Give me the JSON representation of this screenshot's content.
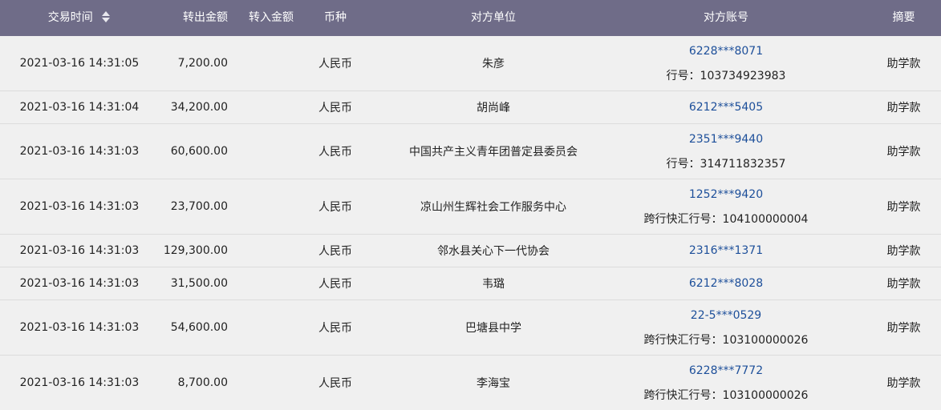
{
  "header": {
    "time": "交易时间",
    "out_amount": "转出金额",
    "in_amount": "转入金额",
    "currency": "币种",
    "counterparty": "对方单位",
    "account": "对方账号",
    "memo": "摘要"
  },
  "rows": [
    {
      "time": "2021-03-16  14:31:05",
      "out": "7,200.00",
      "in": "",
      "currency": "人民币",
      "unit": "朱彦",
      "account": "6228***8071",
      "bank": "行号：103734923983",
      "memo": "助学款"
    },
    {
      "time": "2021-03-16  14:31:04",
      "out": "34,200.00",
      "in": "",
      "currency": "人民币",
      "unit": "胡尚峰",
      "account": "6212***5405",
      "bank": "",
      "memo": "助学款"
    },
    {
      "time": "2021-03-16  14:31:03",
      "out": "60,600.00",
      "in": "",
      "currency": "人民币",
      "unit": "中国共产主义青年团普定县委员会",
      "account": "2351***9440",
      "bank": "行号：314711832357",
      "memo": "助学款"
    },
    {
      "time": "2021-03-16  14:31:03",
      "out": "23,700.00",
      "in": "",
      "currency": "人民币",
      "unit": "凉山州生辉社会工作服务中心",
      "account": "1252***9420",
      "bank": "跨行快汇行号：104100000004",
      "memo": "助学款"
    },
    {
      "time": "2021-03-16  14:31:03",
      "out": "129,300.00",
      "in": "",
      "currency": "人民币",
      "unit": "邻水县关心下一代协会",
      "account": "2316***1371",
      "bank": "",
      "memo": "助学款"
    },
    {
      "time": "2021-03-16  14:31:03",
      "out": "31,500.00",
      "in": "",
      "currency": "人民币",
      "unit": "韦璐",
      "account": "6212***8028",
      "bank": "",
      "memo": "助学款"
    },
    {
      "time": "2021-03-16  14:31:03",
      "out": "54,600.00",
      "in": "",
      "currency": "人民币",
      "unit": "巴塘县中学",
      "account": "22-5***0529",
      "bank": "跨行快汇行号：103100000026",
      "memo": "助学款"
    },
    {
      "time": "2021-03-16  14:31:03",
      "out": "8,700.00",
      "in": "",
      "currency": "人民币",
      "unit": "李海宝",
      "account": "6228***7772",
      "bank": "跨行快汇行号：103100000026",
      "memo": "助学款"
    }
  ],
  "colors": {
    "header_bg": "#6f6c88",
    "row_bg": "#f0f0f0",
    "account_link": "#1d4f9a"
  },
  "icons": {
    "sort": "sort-icon"
  }
}
